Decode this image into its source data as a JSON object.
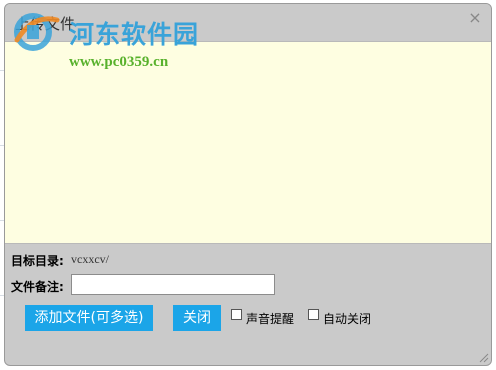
{
  "dialog": {
    "title": "上传文件",
    "close_symbol": "×"
  },
  "watermark": {
    "site_name": "河东软件园",
    "url": "www.pc0359.cn"
  },
  "target_dir": {
    "label": "目标目录:",
    "value": "vcxxcv/"
  },
  "file_note": {
    "label": "文件备注:",
    "value": "",
    "placeholder": ""
  },
  "buttons": {
    "add_files": "添加文件(可多选)",
    "close": "关闭"
  },
  "options": {
    "sound_alert": {
      "label": "声音提醒",
      "checked": false
    },
    "auto_close": {
      "label": "自动关闭",
      "checked": false
    }
  },
  "colors": {
    "dialog_bg": "#cacaca",
    "drop_area_bg": "#fefee1",
    "button_bg": "#1ba5e8",
    "watermark_blue": "#39a3d9",
    "watermark_green": "#58b12c"
  },
  "icons": {
    "watermark_logo": "site-logo",
    "close": "close-icon",
    "resize": "resize-grip-icon"
  }
}
